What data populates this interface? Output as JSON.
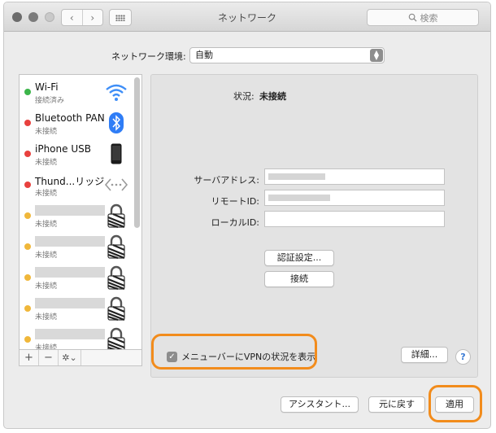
{
  "window": {
    "title": "ネットワーク"
  },
  "search": {
    "placeholder": "検索"
  },
  "location": {
    "label": "ネットワーク環境:",
    "value": "自動"
  },
  "services": [
    {
      "name": "Wi-Fi",
      "status": "接続済み",
      "dot": "#3cb54a",
      "icon": "wifi-icon"
    },
    {
      "name": "Bluetooth PAN",
      "status": "未接続",
      "dot": "#e8413e",
      "icon": "bluetooth-icon"
    },
    {
      "name": "iPhone USB",
      "status": "未接続",
      "dot": "#e8413e",
      "icon": "iphone-icon"
    },
    {
      "name": "Thund...リッジ",
      "status": "未接続",
      "dot": "#e8413e",
      "icon": "thunderbolt-bridge-icon"
    },
    {
      "name": "",
      "status": "未接続",
      "dot": "#f0b73a",
      "icon": "vpn-lock-icon"
    },
    {
      "name": "",
      "status": "未接続",
      "dot": "#f0b73a",
      "icon": "vpn-lock-icon"
    },
    {
      "name": "",
      "status": "未接続",
      "dot": "#f0b73a",
      "icon": "vpn-lock-icon"
    },
    {
      "name": "",
      "status": "未接続",
      "dot": "#f0b73a",
      "icon": "vpn-lock-icon"
    },
    {
      "name": "",
      "status": "未接続",
      "dot": "#f0b73a",
      "icon": "vpn-lock-icon"
    }
  ],
  "list_tools": {
    "add": "+",
    "remove": "−",
    "gear": "✲⌄"
  },
  "detail": {
    "status_label": "状況:",
    "status_value": "未接続",
    "server_label": "サーバアドレス:",
    "remote_id_label": "リモートID:",
    "local_id_label": "ローカルID:",
    "auth_button": "認証設定...",
    "connect_button": "接続",
    "show_vpn_menu": "メニューバーにVPNの状況を表示",
    "advanced_button": "詳細...",
    "help": "?"
  },
  "footer": {
    "assistant": "アシスタント...",
    "revert": "元に戻す",
    "apply": "適用"
  },
  "colors": {
    "highlight": "#f28c1c",
    "connected": "#3cb54a",
    "disconnected": "#e8413e",
    "vpn": "#f0b73a"
  }
}
